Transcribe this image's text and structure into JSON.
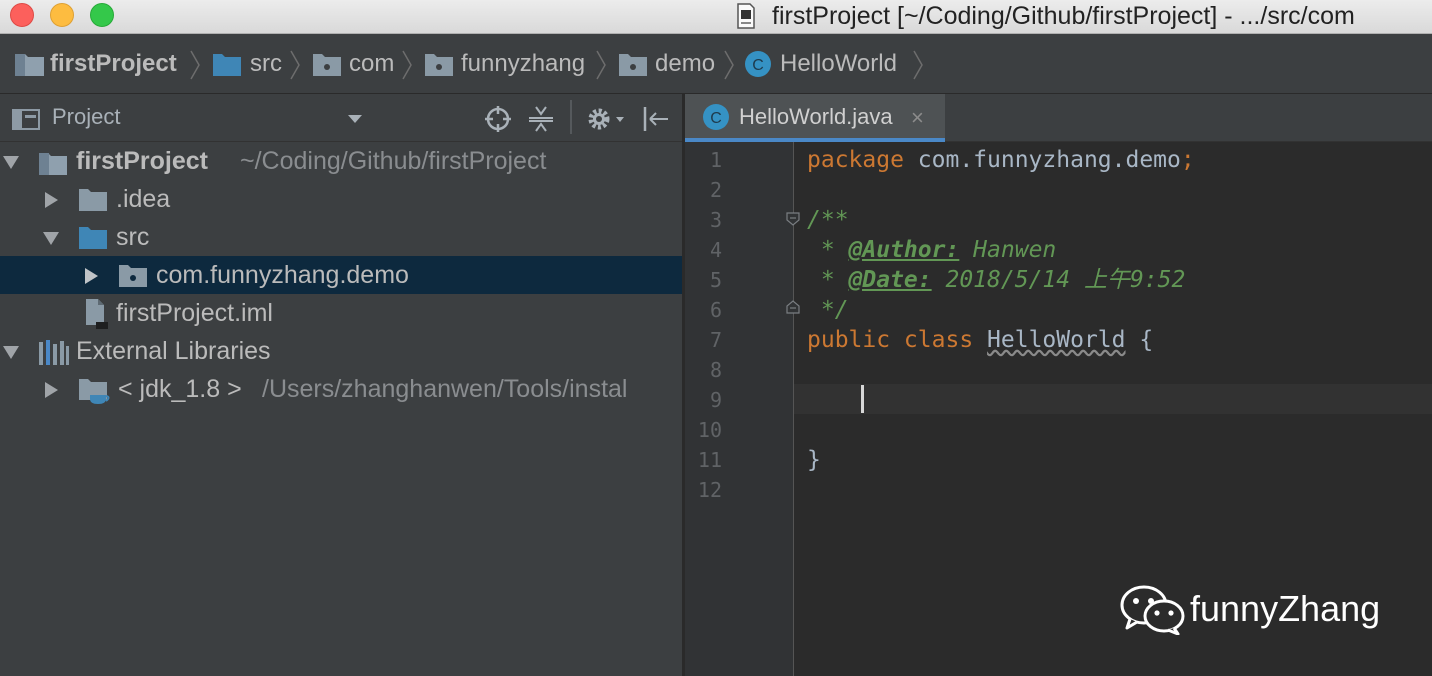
{
  "window": {
    "title": "firstProject [~/Coding/Github/firstProject] - .../src/com"
  },
  "breadcrumb": [
    {
      "label": "firstProject",
      "icon": "project-folder-icon"
    },
    {
      "label": "src",
      "icon": "source-folder-icon"
    },
    {
      "label": "com",
      "icon": "package-icon"
    },
    {
      "label": "funnyzhang",
      "icon": "package-icon"
    },
    {
      "label": "demo",
      "icon": "package-icon"
    },
    {
      "label": "HelloWorld",
      "icon": "class-icon"
    }
  ],
  "project_panel": {
    "title": "Project",
    "tree": [
      {
        "label": "firstProject",
        "path": "~/Coding/Github/firstProject",
        "icon": "project-folder-icon",
        "expanded": true
      },
      {
        "label": ".idea",
        "icon": "folder-icon",
        "expanded": false
      },
      {
        "label": "src",
        "icon": "source-folder-icon",
        "expanded": true
      },
      {
        "label": "com.funnyzhang.demo",
        "icon": "package-icon",
        "expanded": false,
        "selected": true
      },
      {
        "label": "firstProject.iml",
        "icon": "iml-file-icon"
      },
      {
        "label": "External Libraries",
        "icon": "libraries-icon",
        "expanded": true
      },
      {
        "label": "< jdk_1.8 >",
        "path": "/Users/zhanghanwen/Tools/instal",
        "icon": "jdk-icon",
        "expanded": false
      }
    ]
  },
  "editor": {
    "tab": {
      "label": "HelloWorld.java",
      "close": "×"
    },
    "line_numbers": [
      "1",
      "2",
      "3",
      "4",
      "5",
      "6",
      "7",
      "8",
      "9",
      "10",
      "11",
      "12"
    ],
    "code": {
      "l1_kw": "package",
      "l1_rest": " com.funnyzhang.demo",
      "l1_semi": ";",
      "l3": "/**",
      "l4_star": " * ",
      "l4_tag": "@Author:",
      "l4_val": " Hanwen",
      "l5_star": " * ",
      "l5_tag": "@Date:",
      "l5_val": " 2018/5/14 上午9:52",
      "l6": " */",
      "l7_kw": "public class",
      "l7_sp": " ",
      "l7_name": "HelloWorld",
      "l7_brace": " {",
      "l11": "}"
    },
    "caret_line": 9
  },
  "watermark": {
    "text": "funnyZhang",
    "icon": "wechat-icon"
  },
  "colors": {
    "keyword": "#cc7832",
    "doc_comment": "#629755",
    "text": "#a9b7c6",
    "selection": "#0d293e",
    "tab_accent": "#4a88c7"
  }
}
